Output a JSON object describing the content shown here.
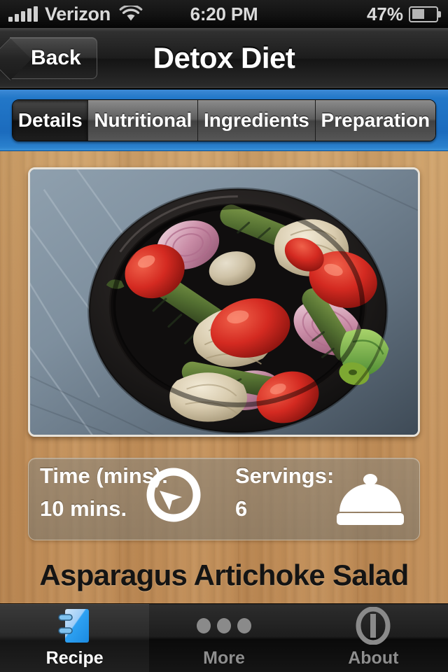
{
  "status_bar": {
    "carrier": "Verizon",
    "time": "6:20 PM",
    "battery_percent": "47%",
    "signal_icon": "signal-bars-icon",
    "wifi_icon": "wifi-icon",
    "battery_icon": "battery-icon",
    "battery_level": 47
  },
  "nav_bar": {
    "back_label": "Back",
    "title": "Detox Diet"
  },
  "segmented_control": {
    "selected": "Details",
    "segments": [
      {
        "label": "Details"
      },
      {
        "label": "Nutritional"
      },
      {
        "label": "Ingredients"
      },
      {
        "label": "Preparation"
      }
    ]
  },
  "recipe": {
    "photo_alt": "asparagus-artichoke-salad-photo",
    "title": "Asparagus Artichoke Salad",
    "info": {
      "time_label": "Time (mins):",
      "time_value": "10 mins.",
      "time_icon": "timer-icon",
      "servings_label": "Servings:",
      "servings_value": "6",
      "servings_icon": "cloche-icon"
    }
  },
  "tab_bar": {
    "selected": "Recipe",
    "tabs": [
      {
        "label": "Recipe",
        "icon": "notebook-icon"
      },
      {
        "label": "More",
        "icon": "ellipsis-icon"
      },
      {
        "label": "About",
        "icon": "info-icon"
      }
    ]
  },
  "colors": {
    "wood": "#c6975f",
    "accent_blue": "#1f74c4",
    "nav_dark": "#1c1c1c",
    "panel_overlay": "rgba(132,126,114,0.64)",
    "tab_active_text": "#ffffff",
    "tab_inactive_text": "#8e8e8e"
  }
}
